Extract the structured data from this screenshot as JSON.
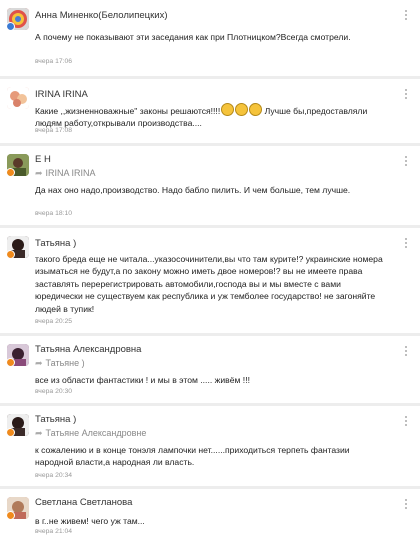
{
  "comments": [
    {
      "author": "Анна Миненко(Белолипецких)",
      "reply_to": "",
      "text": "А почему не показывают эти заседания как при Плотницком?Всегда смотрели.",
      "time": "вчера 17:06",
      "avatar_color": "#c7504a",
      "status_color": "#3a7bd5"
    },
    {
      "author": "IRINA IRINA",
      "reply_to": "",
      "text_before": "Какие ,,жизненноважные\" законы решаются!!!!",
      "text_after": " Лучше бы,предоставляли людям работу,открывали производства....",
      "time": "вчера 17:08",
      "avatar_color": "#e7a6a0",
      "status_color": ""
    },
    {
      "author": "Е Н",
      "reply_to": "IRINA IRINA",
      "text": "Да нах оно надо,производство. Надо бабло пилить. И чем больше, тем лучше.",
      "time": "вчера 18:10",
      "avatar_color": "#6f7a4a",
      "status_color": "#f08a1c"
    },
    {
      "author": "Татьяна )",
      "reply_to": "",
      "text": "такого бреда еще не читала...указосочинители,вы что там курите!? украинские номера изыматься не будут,а по закону можно иметь двое номеров!? вы не имеете права заставлять перерегистрировать автомобили,господа вы и мы вместе с вами юредически не существуем как республика и уж темболее государство! не загоняйте людей в тупик!",
      "time": "вчера 20:25",
      "avatar_color": "#3a2a28",
      "status_color": "#f08a1c"
    },
    {
      "author": "Татьяна Александровна",
      "reply_to": "Татьяне )",
      "text": "все из области фантастики ! и мы в этом ..... живём !!!",
      "time": "вчера 20:30",
      "avatar_color": "#7a4a6a",
      "status_color": "#f08a1c"
    },
    {
      "author": "Татьяна )",
      "reply_to": "Татьяне Александровне",
      "text": "к сожалению и в конце тонэля лампочки нет......приходиться терпеть фантазии народной власти,а народная ли власть.",
      "time": "вчера 20:34",
      "avatar_color": "#3a2a28",
      "status_color": "#f08a1c"
    },
    {
      "author": "Светлана Светланова",
      "reply_to": "",
      "text": "в г..не живем! чего уж там...",
      "time": "вчера 21:04",
      "avatar_color": "#c98a7a",
      "status_color": "#f08a1c"
    }
  ]
}
